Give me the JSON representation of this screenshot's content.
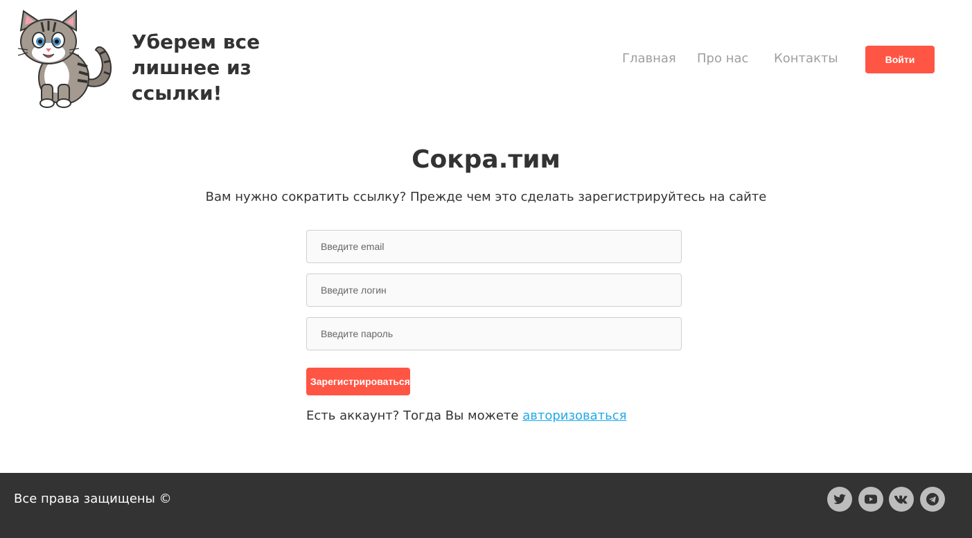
{
  "header": {
    "logo_icon": "cat-mascot-icon",
    "slogan": "Уберем все лишнее из ссылки!",
    "nav": {
      "home": "Главная",
      "about": "Про нас",
      "contacts": "Контакты"
    },
    "login_button": "Войти"
  },
  "main": {
    "title": "Сокра.тим",
    "subtitle": "Вам нужно сократить ссылку? Прежде чем это сделать зарегистрируйтесь на сайте",
    "form": {
      "email_placeholder": "Введите email",
      "login_placeholder": "Введите логин",
      "password_placeholder": "Введите пароль",
      "email_value": "",
      "login_value": "",
      "password_value": "",
      "submit_label": "Зарегистрироваться"
    },
    "account_prompt": "Есть аккаунт? Тогда Вы можете",
    "account_link": "авторизоваться"
  },
  "footer": {
    "copyright": "Все права защищены ©",
    "social_icons": [
      "twitter-icon",
      "youtube-icon",
      "vk-icon",
      "telegram-icon"
    ]
  },
  "colors": {
    "accent": "#ff5544",
    "link": "#1fa9e6",
    "footer_bg": "#333333",
    "nav_text": "#9e9e9e",
    "social_bg": "#bdbdbd"
  }
}
